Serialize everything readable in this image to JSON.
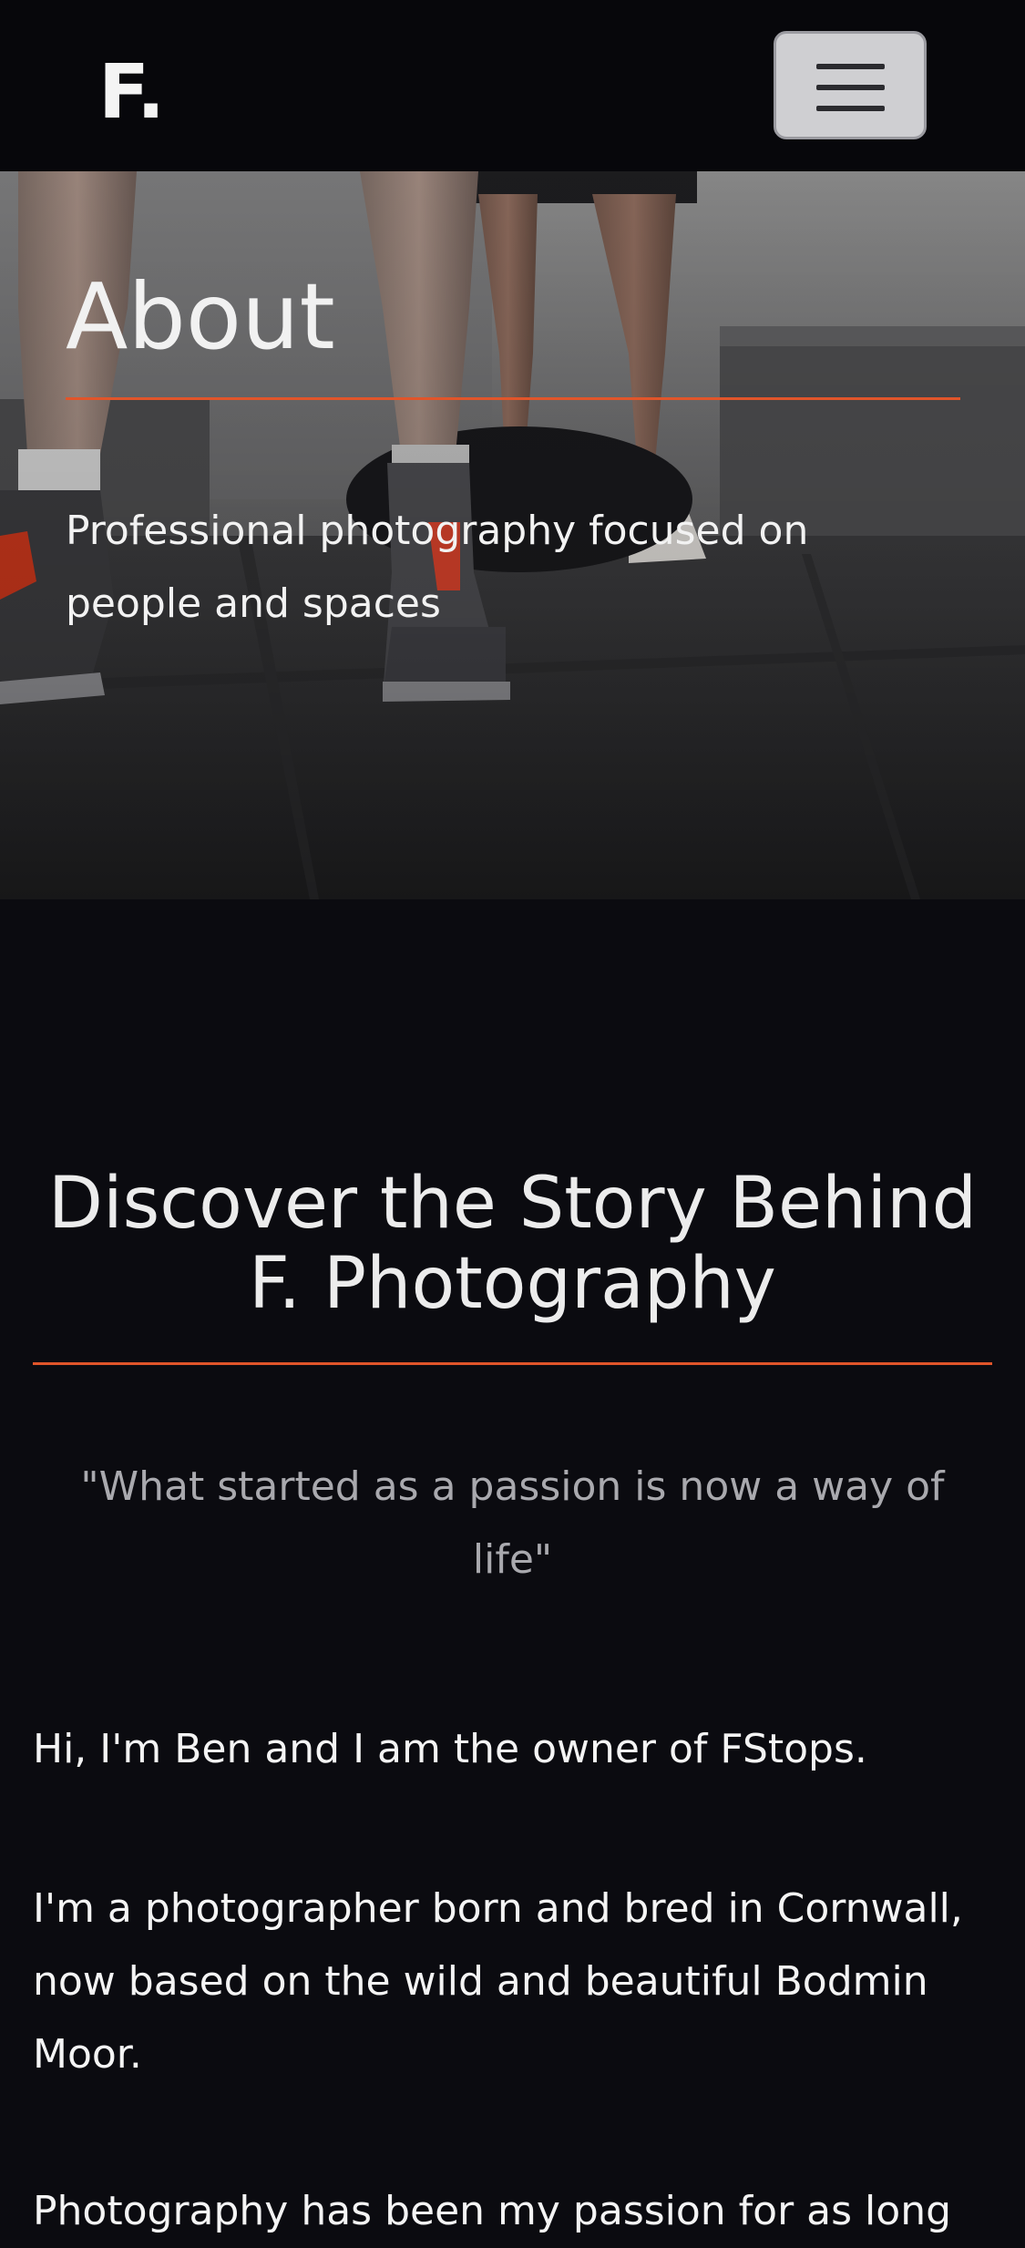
{
  "navbar": {
    "brand": "F.",
    "menu_icon": "hamburger-menu-icon"
  },
  "hero": {
    "title": "About",
    "subtitle": "Professional photography focused on people and spaces",
    "accent_color": "#e1552a"
  },
  "story": {
    "title": "Discover the Story Behind F. Photography",
    "quote": "\"What started as a passion is now a way of life\"",
    "paragraphs": [
      "Hi, I'm Ben and I am the owner of FStops.",
      "I'm a photographer born and bred in Cornwall, now based on the wild and beautiful Bodmin Moor.",
      "Photography has been my passion for as long"
    ]
  }
}
